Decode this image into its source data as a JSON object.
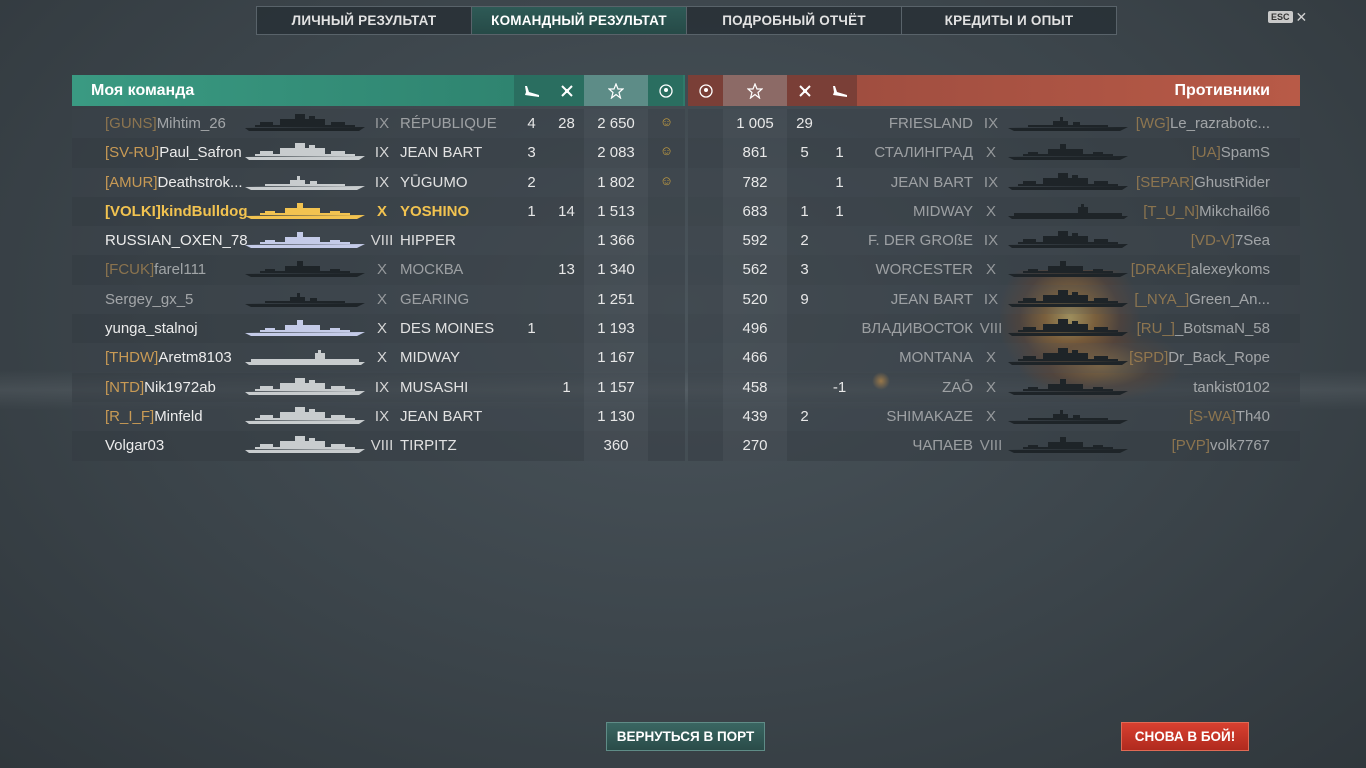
{
  "tabs": [
    {
      "label": "ЛИЧНЫЙ РЕЗУЛЬТАТ",
      "active": false
    },
    {
      "label": "КОМАНДНЫЙ РЕЗУЛЬТАТ",
      "active": true
    },
    {
      "label": "ПОДРОБНЫЙ ОТЧЁТ",
      "active": false
    },
    {
      "label": "КРЕДИТЫ И ОПЫТ",
      "active": false
    }
  ],
  "esc": {
    "key": "ESC",
    "close": "✕"
  },
  "my_team": {
    "title": "Моя команда",
    "columns": [
      {
        "icon": "plane-down-icon",
        "glyph": "⛴"
      },
      {
        "icon": "kills-icon",
        "glyph": "✕"
      },
      {
        "icon": "star-icon",
        "glyph": "☆"
      },
      {
        "icon": "laurel-icon",
        "glyph": "☺"
      }
    ],
    "rows": [
      {
        "clan": "[GUNS]",
        "name": "Mihtim_26",
        "tier": "IX",
        "ship": "RÉPUBLIQUE",
        "planes": "4",
        "kills": "28",
        "exp": "2 650",
        "award": "☺",
        "state": "dim",
        "sil": "bb"
      },
      {
        "clan": "[SV-RU]",
        "name": "Paul_Safron",
        "tier": "IX",
        "ship": "JEAN BART",
        "planes": "3",
        "kills": "",
        "exp": "2 083",
        "award": "☺",
        "state": "alive",
        "sil": "bb"
      },
      {
        "clan": "[AMUR]",
        "name": "Deathstrok...",
        "tier": "IX",
        "ship": "YŪGUMO",
        "planes": "2",
        "kills": "",
        "exp": "1 802",
        "award": "☺",
        "state": "alive",
        "sil": "dd"
      },
      {
        "clan": "[VOLKI]",
        "name": "kindBulldog",
        "tier": "X",
        "ship": "YOSHINO",
        "planes": "1",
        "kills": "14",
        "exp": "1 513",
        "award": "",
        "state": "me",
        "sil": "ca"
      },
      {
        "clan": "",
        "name": "RUSSIAN_OXEN_78",
        "tier": "VIII",
        "ship": "HIPPER",
        "planes": "",
        "kills": "",
        "exp": "1 366",
        "award": "",
        "state": "alive",
        "sil": "ca"
      },
      {
        "clan": "[FCUK]",
        "name": "farel111",
        "tier": "X",
        "ship": "МОСКВА",
        "planes": "",
        "kills": "13",
        "exp": "1 340",
        "award": "",
        "state": "dim",
        "sil": "ca"
      },
      {
        "clan": "",
        "name": "Sergey_gx_5",
        "tier": "X",
        "ship": "GEARING",
        "planes": "",
        "kills": "",
        "exp": "1 251",
        "award": "",
        "state": "dim",
        "sil": "dd"
      },
      {
        "clan": "",
        "name": "yunga_stalnoj",
        "tier": "X",
        "ship": "DES MOINES",
        "planes": "1",
        "kills": "",
        "exp": "1 193",
        "award": "",
        "state": "alive",
        "sil": "ca"
      },
      {
        "clan": "[THDW]",
        "name": "Aretm8103",
        "tier": "X",
        "ship": "MIDWAY",
        "planes": "",
        "kills": "",
        "exp": "1 167",
        "award": "",
        "state": "alive",
        "sil": "cv"
      },
      {
        "clan": "[NTD]",
        "name": "Nik1972ab",
        "tier": "IX",
        "ship": "MUSASHI",
        "planes": "",
        "kills": "1",
        "exp": "1 157",
        "award": "",
        "state": "alive",
        "sil": "bb"
      },
      {
        "clan": "[R_I_F]",
        "name": "Minfeld",
        "tier": "IX",
        "ship": "JEAN BART",
        "planes": "",
        "kills": "",
        "exp": "1 130",
        "award": "",
        "state": "alive",
        "sil": "bb"
      },
      {
        "clan": "",
        "name": "Volgar03",
        "tier": "VIII",
        "ship": "TIRPITZ",
        "planes": "",
        "kills": "",
        "exp": "360",
        "award": "",
        "state": "alive",
        "sil": "bb"
      }
    ]
  },
  "enemy_team": {
    "title": "Противники",
    "rows": [
      {
        "clan": "[WG]",
        "name": "Le_razrabotc...",
        "tier": "IX",
        "ship": "FRIESLAND",
        "exp": "1 005",
        "kills": "29",
        "planes": "",
        "state": "dim",
        "sil": "dd"
      },
      {
        "clan": "[UA]",
        "name": "SpamS",
        "tier": "X",
        "ship": "СТАЛИНГРАД",
        "exp": "861",
        "kills": "5",
        "planes": "1",
        "state": "dim",
        "sil": "ca"
      },
      {
        "clan": "[SEPAR]",
        "name": "GhustRider",
        "tier": "IX",
        "ship": "JEAN BART",
        "exp": "782",
        "kills": "",
        "planes": "1",
        "state": "dim",
        "sil": "bb"
      },
      {
        "clan": "[T_U_N]",
        "name": "Mikchail66",
        "tier": "X",
        "ship": "MIDWAY",
        "exp": "683",
        "kills": "1",
        "planes": "1",
        "state": "dim",
        "sil": "cv"
      },
      {
        "clan": "[VD-V]",
        "name": "7Sea",
        "tier": "IX",
        "ship": "F. DER GROßE",
        "exp": "592",
        "kills": "2",
        "planes": "",
        "state": "dim",
        "sil": "bb"
      },
      {
        "clan": "[DRAKE]",
        "name": "alexeykoms",
        "tier": "X",
        "ship": "WORCESTER",
        "exp": "562",
        "kills": "3",
        "planes": "",
        "state": "dim",
        "sil": "ca"
      },
      {
        "clan": "[_NYA_]",
        "name": "Green_An...",
        "tier": "IX",
        "ship": "JEAN BART",
        "exp": "520",
        "kills": "9",
        "planes": "",
        "state": "dim",
        "sil": "bb"
      },
      {
        "clan": "[RU_]",
        "name": "_BotsmaN_58",
        "tier": "VIII",
        "ship": "ВЛАДИВОСТОК",
        "exp": "496",
        "kills": "",
        "planes": "",
        "state": "dim",
        "sil": "bb"
      },
      {
        "clan": "[SPD]",
        "name": "Dr_Back_Rope",
        "tier": "X",
        "ship": "MONTANA",
        "exp": "466",
        "kills": "",
        "planes": "",
        "state": "dim",
        "sil": "bb"
      },
      {
        "clan": "",
        "name": "tankist0102",
        "tier": "X",
        "ship": "ZAŌ",
        "exp": "458",
        "kills": "",
        "planes": "-1",
        "state": "dim",
        "sil": "ca"
      },
      {
        "clan": "[S-WA]",
        "name": "Th40",
        "tier": "X",
        "ship": "SHIMAKAZE",
        "exp": "439",
        "kills": "2",
        "planes": "",
        "state": "dim",
        "sil": "dd"
      },
      {
        "clan": "[PVP]",
        "name": "volk7767",
        "tier": "VIII",
        "ship": "ЧАПАЕВ",
        "exp": "270",
        "kills": "",
        "planes": "",
        "state": "dim",
        "sil": "ca"
      }
    ]
  },
  "buttons": {
    "port": "ВЕРНУТЬСЯ В ПОРТ",
    "battle": "СНОВА В БОЙ!"
  }
}
